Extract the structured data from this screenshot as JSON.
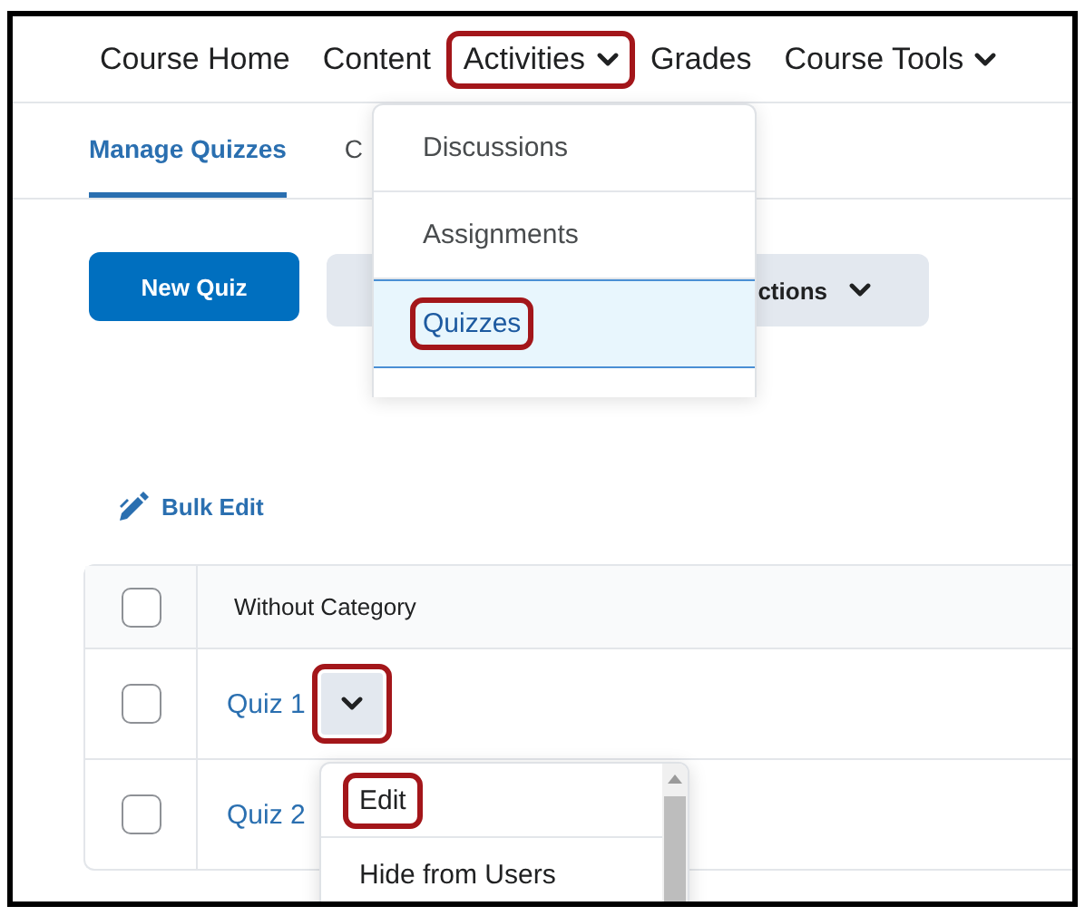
{
  "nav": [
    {
      "label": "Course Home",
      "has_menu": false,
      "highlighted": false
    },
    {
      "label": "Content",
      "has_menu": false,
      "highlighted": false
    },
    {
      "label": "Activities",
      "has_menu": true,
      "highlighted": true
    },
    {
      "label": "Grades",
      "has_menu": false,
      "highlighted": false
    },
    {
      "label": "Course Tools",
      "has_menu": true,
      "highlighted": false
    }
  ],
  "tabs": [
    {
      "label": "Manage Quizzes",
      "selected": true
    },
    {
      "label": "C",
      "selected": false
    }
  ],
  "actions": {
    "new_button": "New Quiz",
    "more_button": "ctions"
  },
  "activities_menu": {
    "items": [
      {
        "label": "Discussions",
        "selected": false,
        "highlighted": false
      },
      {
        "label": "Assignments",
        "selected": false,
        "highlighted": false
      },
      {
        "label": "Quizzes",
        "selected": true,
        "highlighted": true
      }
    ]
  },
  "bulk_edit": "Bulk Edit",
  "table": {
    "header": {
      "label": "Without Category",
      "checked": false
    },
    "rows": [
      {
        "name": "Quiz 1",
        "checked": false,
        "has_menu": true,
        "highlighted": true
      },
      {
        "name": "Quiz 2",
        "checked": false,
        "has_menu": false
      }
    ]
  },
  "row_menu": {
    "items": [
      {
        "label": "Edit",
        "highlighted": true
      },
      {
        "label": "Hide from Users",
        "highlighted": false
      }
    ]
  }
}
